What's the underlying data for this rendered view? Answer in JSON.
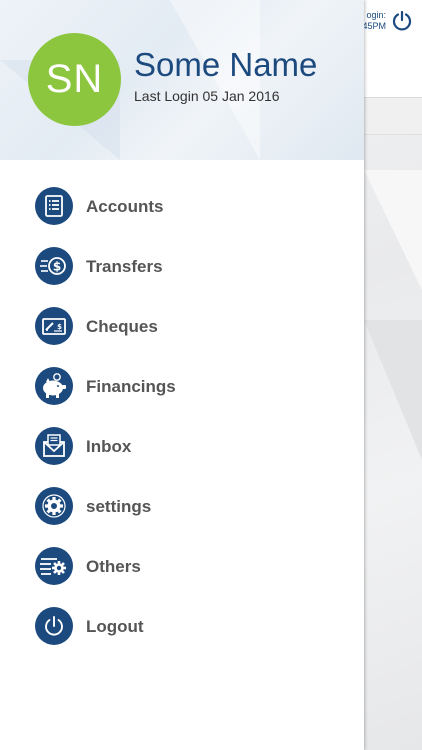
{
  "background": {
    "login_line1": "ogin:",
    "login_line2": "45PM",
    "power_icon": "power-icon"
  },
  "drawer": {
    "avatar_initials": "SN",
    "user_name": "Some Name",
    "last_login": "Last Login 05 Jan 2016",
    "accent_color": "#1c4a7e",
    "avatar_color": "#8cc63e",
    "menu": [
      {
        "label": "Accounts",
        "icon": "accounts-list-icon"
      },
      {
        "label": "Transfers",
        "icon": "transfer-dollar-icon"
      },
      {
        "label": "Cheques",
        "icon": "cheque-icon"
      },
      {
        "label": "Financings",
        "icon": "piggy-bank-icon"
      },
      {
        "label": "Inbox",
        "icon": "mail-icon"
      },
      {
        "label": "settings",
        "icon": "gear-icon"
      },
      {
        "label": "Others",
        "icon": "others-gear-icon"
      },
      {
        "label": "Logout",
        "icon": "power-icon"
      }
    ]
  }
}
